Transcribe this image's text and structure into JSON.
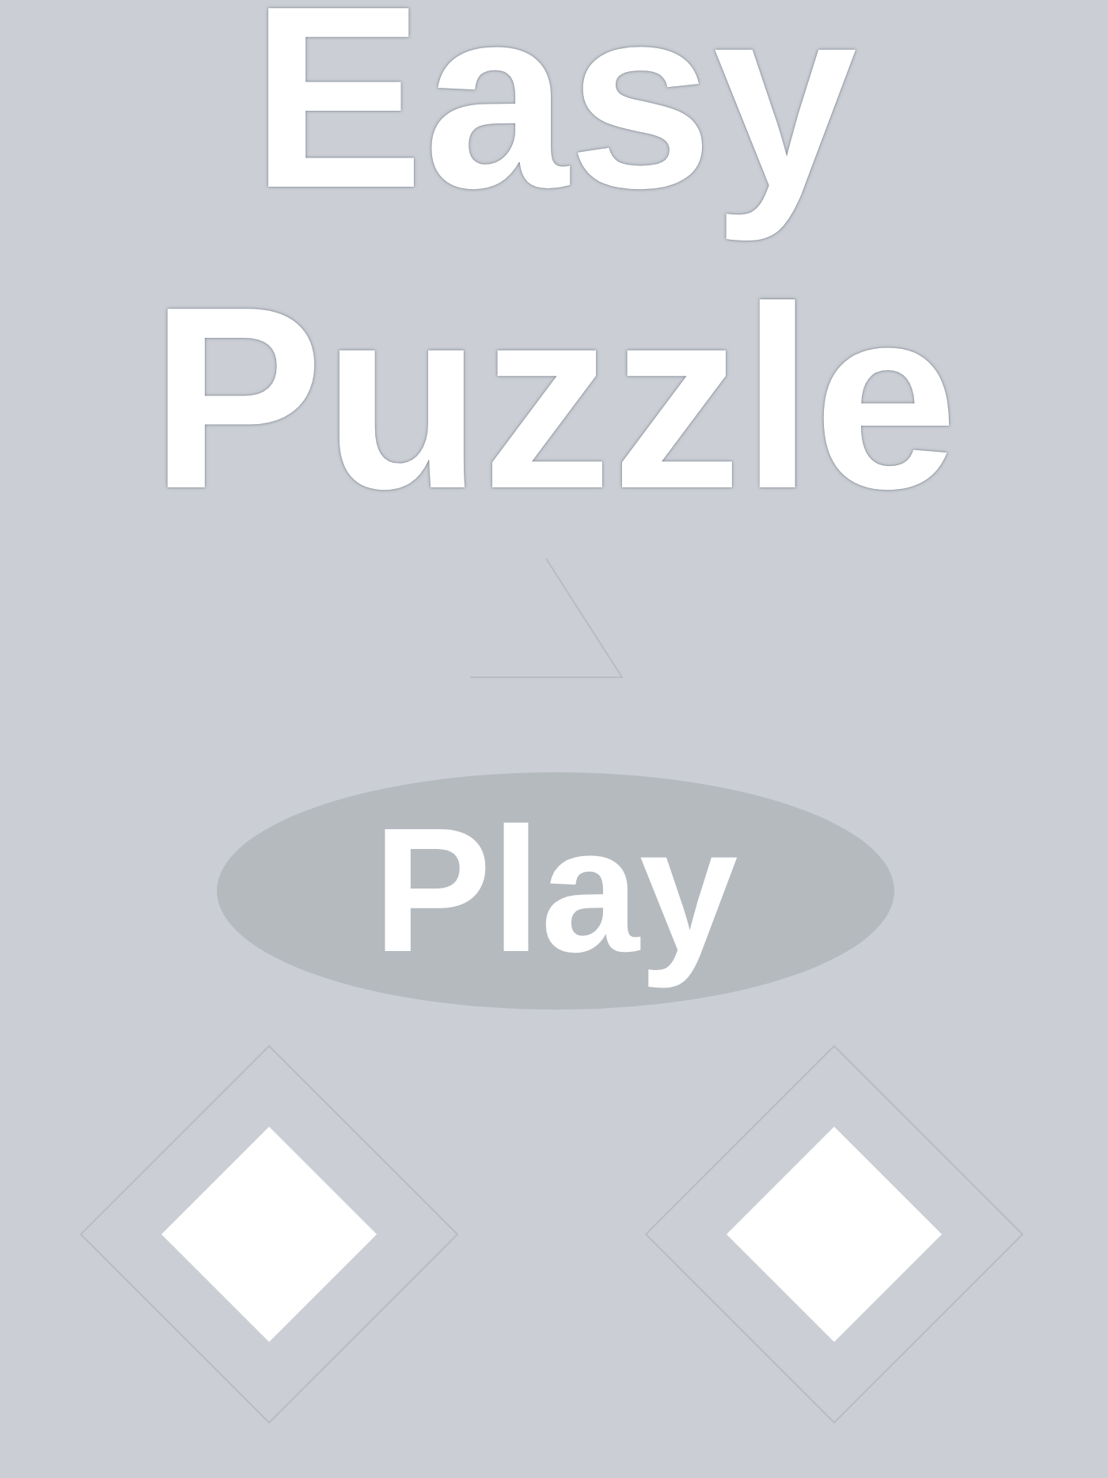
{
  "title": [
    "Easy",
    "Puzzle"
  ],
  "play_button": {
    "label": "Play"
  }
}
